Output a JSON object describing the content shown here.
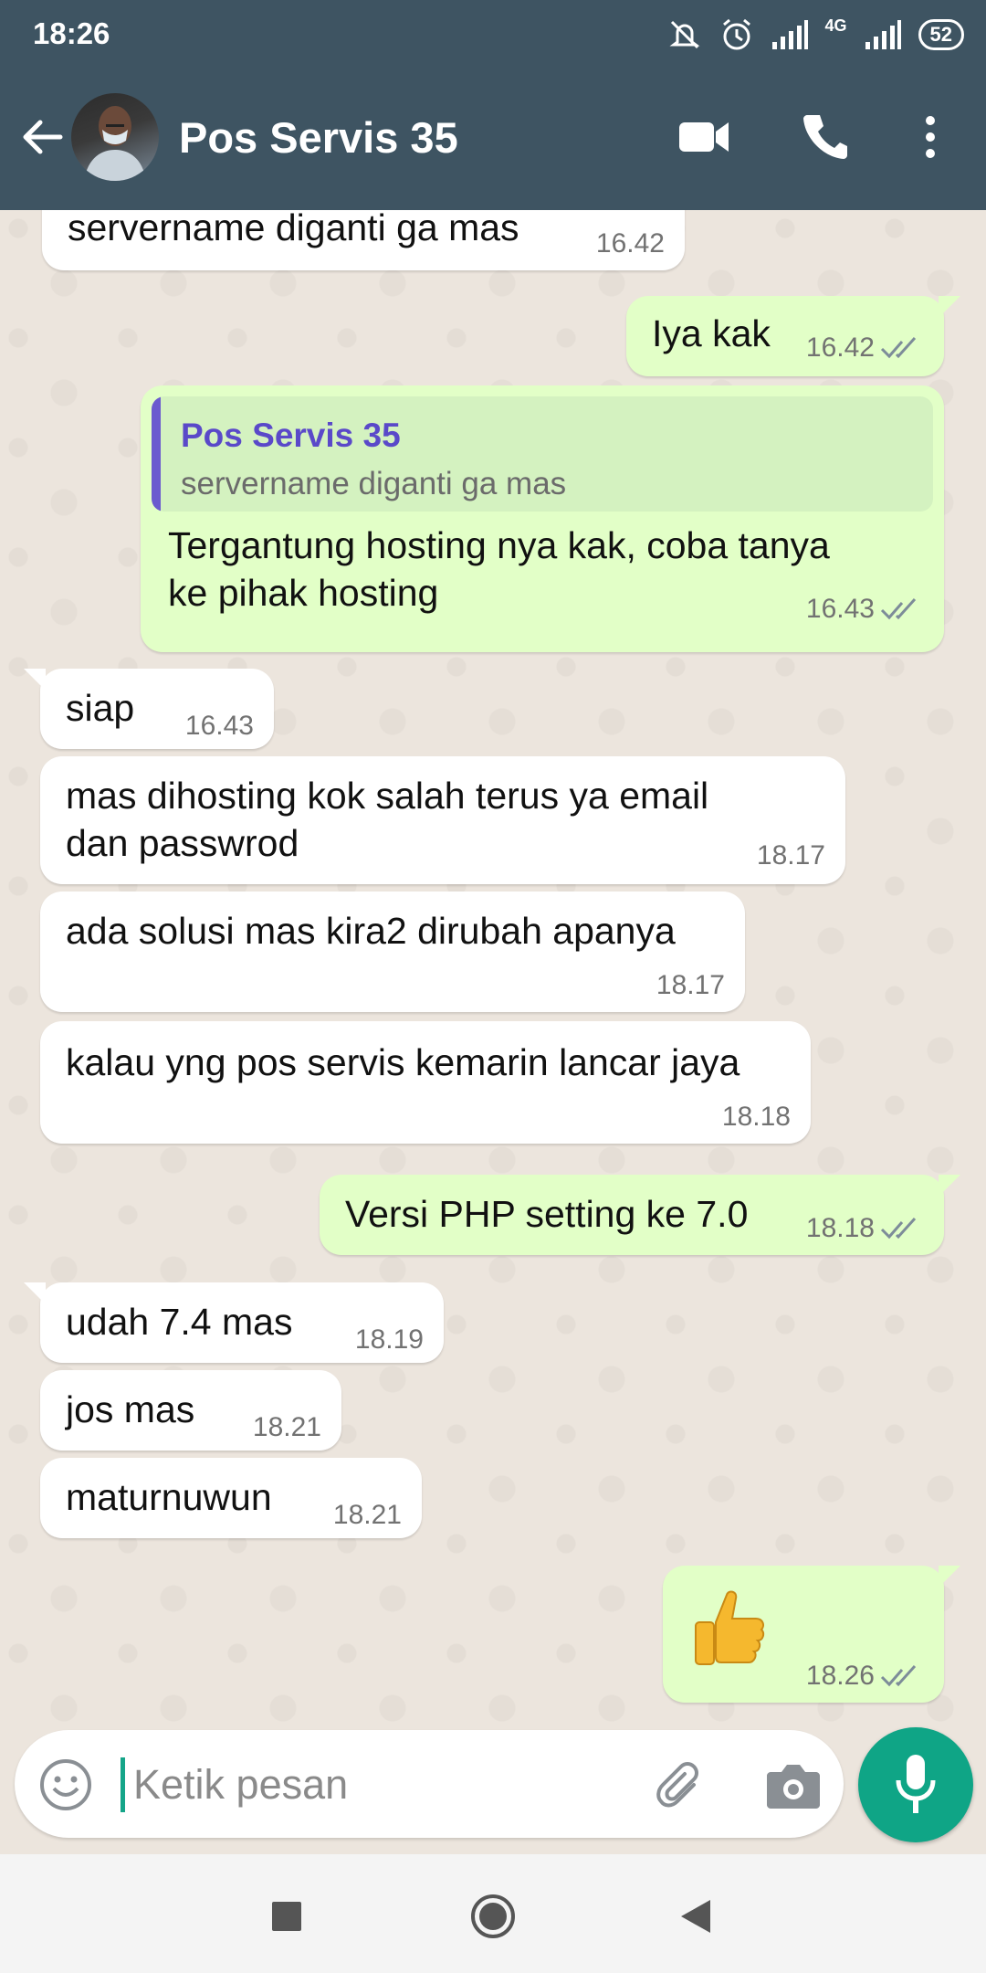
{
  "status_bar": {
    "time": "18:26",
    "network": "4G",
    "battery": "52"
  },
  "header": {
    "contact_name": "Pos Servis 35"
  },
  "messages": [
    {
      "text": "servername diganti ga mas",
      "time": "16.42"
    },
    {
      "text": "Iya kak",
      "time": "16.42"
    },
    {
      "quote_author": "Pos Servis 35",
      "quote_text": "servername diganti ga mas",
      "text_line1": "Tergantung hosting nya kak, coba tanya",
      "text_line2": "ke pihak hosting",
      "time": "16.43"
    },
    {
      "text": "siap",
      "time": "16.43"
    },
    {
      "text_line1": "mas dihosting kok salah terus ya email",
      "text_line2": "dan passwrod",
      "time": "18.17"
    },
    {
      "text": "ada solusi mas kira2 dirubah apanya",
      "time": "18.17"
    },
    {
      "text": "kalau yng pos servis kemarin lancar jaya",
      "time": "18.18"
    },
    {
      "text": "Versi PHP setting ke 7.0",
      "time": "18.18"
    },
    {
      "text": "udah 7.4 mas",
      "time": "18.19"
    },
    {
      "text": "jos mas",
      "time": "18.21"
    },
    {
      "text": "maturnuwun",
      "time": "18.21"
    },
    {
      "emoji": "👍",
      "time": "18.26"
    }
  ],
  "composer": {
    "placeholder": "Ketik pesan"
  },
  "colors": {
    "header": "#3e5462",
    "outgoing": "#e2ffc7",
    "incoming": "#ffffff",
    "accent": "#0fa586",
    "ticks": "#7d8c99"
  }
}
